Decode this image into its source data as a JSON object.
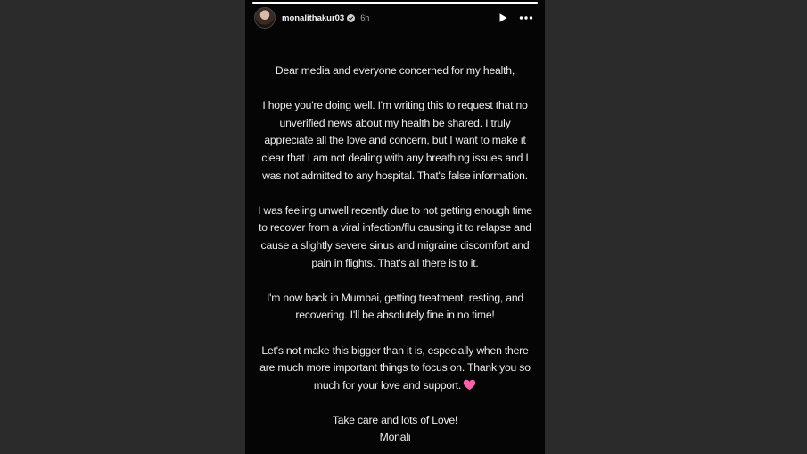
{
  "header": {
    "username": "monalithakur03",
    "timestamp": "6h",
    "avatar_icon": "profile-avatar",
    "verified_icon": "verified-badge-icon",
    "play_icon": "play-icon",
    "more_icon": "more-options-icon"
  },
  "progress": {
    "fraction": 1.0
  },
  "message": {
    "salutation": "Dear media and everyone concerned for my health,",
    "para1": "I hope you're doing well. I'm writing this to request that no unverified news about my health be shared. I truly appreciate all the love and concern, but I want to make it clear that I am not dealing with any breathing issues and I was not admitted to any hospital. That's false information.",
    "para2": "I was feeling unwell recently due to not getting enough time to recover from a viral infection/flu causing it to relapse and cause a slightly severe sinus and migraine discomfort and pain in flights. That's all there is to it.",
    "para3": "I'm now back in Mumbai, getting treatment, resting, and recovering. I'll be absolutely fine in no time!",
    "para4": "Let's not make this bigger than it is, especially when there are much more important things to focus on. Thank you so much for your love and support.",
    "emoji": "pink-heart-emoji",
    "closing": "Take care and lots of Love!",
    "signature": "Monali"
  },
  "colors": {
    "page_background": "#2b2b2b",
    "story_background": "#050505",
    "text": "#ececec",
    "heart": "#ff5fa8"
  }
}
